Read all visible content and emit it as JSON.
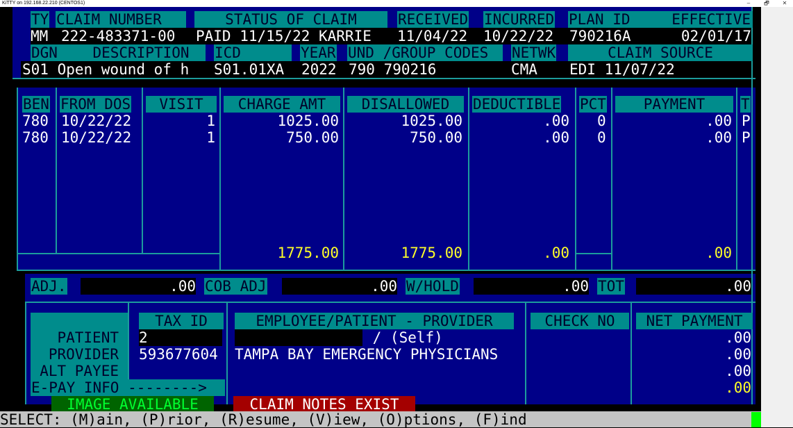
{
  "window": {
    "title": "KiTTY on 192.168.22.210 (CENTOS1)",
    "minimize": "–",
    "maximize": "🗗",
    "close": "✕"
  },
  "header": {
    "ty_label": "TY",
    "claim_number_label": "CLAIM NUMBER",
    "status_label": "STATUS OF CLAIM",
    "received_label": "RECEIVED",
    "incurred_label": "INCURRED",
    "plan_id_label": "PLAN ID",
    "effective_label": "EFFECTIVE",
    "ty": "MM",
    "claim_number": "222-483371-00",
    "status": "PAID 11/15/22 KARRIE",
    "received": "11/04/22",
    "incurred": "10/22/22",
    "plan_id": "790216A",
    "effective": "02/01/17",
    "dgn_label": "DGN",
    "description_label": "DESCRIPTION",
    "icd_label": "ICD",
    "year_label": "YEAR",
    "fund_label": "UND /GROUP CODES",
    "netwk_label": "NETWK",
    "source_label": "CLAIM SOURCE",
    "dgn_desc": "S01 Open wound of h",
    "icd": "S01.01XA",
    "year": "2022",
    "fund": "790 790216",
    "netwk": "CMA",
    "source": "EDI 11/07/22"
  },
  "lines": {
    "columns": [
      "BEN",
      "FROM DOS",
      "VISIT",
      "CHARGE AMT",
      "DISALLOWED",
      "DEDUCTIBLE",
      "PCT",
      "PAYMENT",
      "T"
    ],
    "rows": [
      {
        "ben": "780",
        "dos": "10/22/22",
        "visit": "1",
        "charge": "1025.00",
        "disallowed": "1025.00",
        "deductible": ".00",
        "pct": "0",
        "payment": ".00",
        "t": "P"
      },
      {
        "ben": "780",
        "dos": "10/22/22",
        "visit": "1",
        "charge": "750.00",
        "disallowed": "750.00",
        "deductible": ".00",
        "pct": "0",
        "payment": ".00",
        "t": "P"
      }
    ],
    "totals": {
      "charge": "1775.00",
      "disallowed": "1775.00",
      "deductible": ".00",
      "payment": ".00"
    }
  },
  "adjustments": {
    "adj_label": "ADJ.",
    "adj": ".00",
    "cob_label": "COB ADJ",
    "cob": ".00",
    "whold_label": "W/HOLD",
    "whold": ".00",
    "tot_label": "TOT",
    "tot": ".00"
  },
  "payee": {
    "tax_id_label": "TAX ID",
    "emp_label": "EMPLOYEE/PATIENT - PROVIDER",
    "check_label": "CHECK NO",
    "net_label": "NET PAYMENT",
    "patient_label": "PATIENT",
    "provider_label": "PROVIDER",
    "alt_label": "ALT PAYEE",
    "epay_label": "E-PAY INFO -------->",
    "patient_tax": "2",
    "patient_name": " / (Self)",
    "patient_net": ".00",
    "provider_tax": "593677604",
    "provider_name": "TAMPA BAY EMERGENCY PHYSICIANS",
    "provider_net": ".00",
    "alt_net": ".00",
    "epay_net": ".00"
  },
  "flags": {
    "image": "IMAGE AVAILABLE",
    "notes": "CLAIM NOTES EXIST"
  },
  "status_line": "SELECT: (M)ain, (P)rior, (R)esume, (V)iew, (O)ptions, (F)ind"
}
